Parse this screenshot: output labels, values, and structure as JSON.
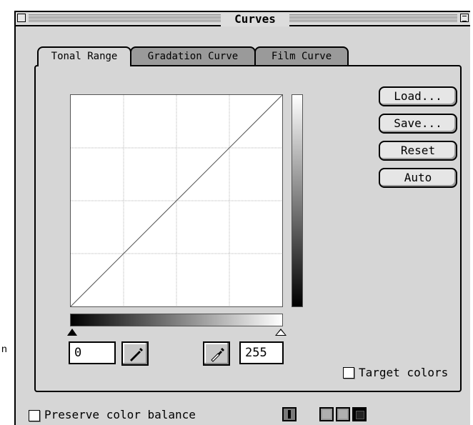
{
  "page": {
    "stray_text": "n"
  },
  "window": {
    "title": "Curves"
  },
  "tabs": [
    {
      "label": "Tonal Range",
      "active": true
    },
    {
      "label": "Gradation Curve",
      "active": false
    },
    {
      "label": "Film Curve",
      "active": false
    }
  ],
  "buttons": {
    "load": "Load...",
    "save": "Save...",
    "reset": "Reset",
    "auto": "Auto"
  },
  "inputs": {
    "black_point": "0",
    "white_point": "255"
  },
  "checkboxes": {
    "target_colors": {
      "label": "Target colors",
      "checked": false
    },
    "preserve_color_balance": {
      "label": "Preserve color balance",
      "checked": false
    }
  },
  "icons": {
    "black_dropper": "eyedropper-black-icon",
    "white_dropper": "eyedropper-white-icon",
    "close": "close-box-icon",
    "zoom": "zoom-box-icon"
  },
  "colors": {
    "window_bg": "#d6d6d6",
    "inactive_tab": "#9a9a9a",
    "curve_bg": "#ffffff"
  }
}
